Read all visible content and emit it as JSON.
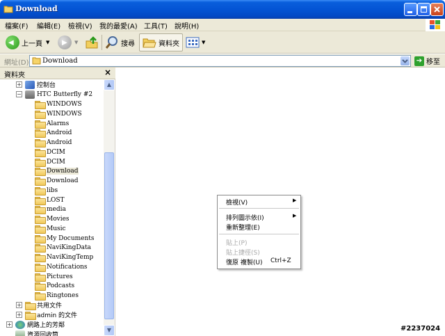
{
  "window": {
    "title": "Download"
  },
  "menubar": {
    "items": [
      "檔案(F)",
      "編輯(E)",
      "檢視(V)",
      "我的最愛(A)",
      "工具(T)",
      "說明(H)"
    ]
  },
  "toolbar": {
    "back_label": "上一頁",
    "search_label": "搜尋",
    "folders_label": "資料夾"
  },
  "address": {
    "label": "網址(D)",
    "value": "Download",
    "go_label": "移至"
  },
  "folder_pane": {
    "title": "資料夾",
    "close": "×",
    "nodes": [
      {
        "label": "控制台"
      },
      {
        "label": "HTC Butterfly #2"
      },
      {
        "label": "WINDOWS"
      },
      {
        "label": "WINDOWS"
      },
      {
        "label": "Alarms"
      },
      {
        "label": "Android"
      },
      {
        "label": "Android"
      },
      {
        "label": "DCIM"
      },
      {
        "label": "DCIM"
      },
      {
        "label": "Download"
      },
      {
        "label": "Download"
      },
      {
        "label": "libs"
      },
      {
        "label": "LOST"
      },
      {
        "label": "media"
      },
      {
        "label": "Movies"
      },
      {
        "label": "Music"
      },
      {
        "label": "My Documents"
      },
      {
        "label": "NaviKingData"
      },
      {
        "label": "NaviKingTemp"
      },
      {
        "label": "Notifications"
      },
      {
        "label": "Pictures"
      },
      {
        "label": "Podcasts"
      },
      {
        "label": "Ringtones"
      },
      {
        "label": "共用文件"
      },
      {
        "label": "admin 的文件"
      },
      {
        "label": "網路上的芳鄰"
      },
      {
        "label": "資源回收筒"
      }
    ]
  },
  "context_menu": {
    "items": [
      {
        "label": "檢視(V)"
      },
      {
        "label": "排列圖示依(I)"
      },
      {
        "label": "重新整理(E)"
      },
      {
        "label": "貼上(P)"
      },
      {
        "label": "貼上捷徑(S)"
      },
      {
        "label": "復原 複製(U)",
        "shortcut": "Ctrl+Z"
      }
    ]
  },
  "watermark": "#2237024"
}
